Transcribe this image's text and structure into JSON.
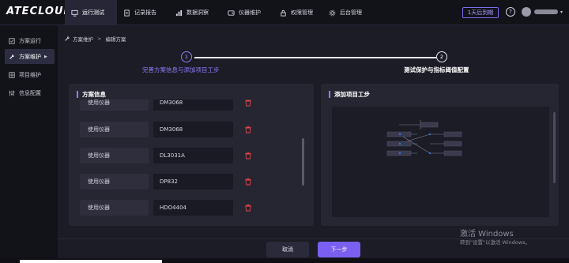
{
  "app": {
    "logo": "ATECLOUD"
  },
  "nav": [
    {
      "label": "运行测试",
      "icon": "monitor-icon",
      "active": true
    },
    {
      "label": "记录报告",
      "icon": "report-icon",
      "active": false
    },
    {
      "label": "数据洞察",
      "icon": "chart-icon",
      "active": false
    },
    {
      "label": "仪器维护",
      "icon": "instrument-icon",
      "active": false
    },
    {
      "label": "权限管理",
      "icon": "lock-icon",
      "active": false
    },
    {
      "label": "后台管理",
      "icon": "settings-icon",
      "active": false
    }
  ],
  "header": {
    "trial_label": "1天后到期",
    "help_label": "?"
  },
  "sidebar": [
    {
      "label": "方案运行",
      "icon": "play-icon",
      "active": false
    },
    {
      "label": "方案维护",
      "icon": "wrench-icon",
      "active": true,
      "caret": "▶"
    },
    {
      "label": "项目维护",
      "icon": "grid-icon",
      "active": false
    },
    {
      "label": "信息配置",
      "icon": "sliders-icon",
      "active": false
    }
  ],
  "breadcrumb": {
    "root": "方案维护",
    "separator": ">",
    "current": "编辑方案"
  },
  "steps": [
    {
      "number": "1",
      "label": "完善方案信息与添加项目工步",
      "active": true
    },
    {
      "number": "2",
      "label": "测试保护与指标阈值配置",
      "active": false
    }
  ],
  "left_panel": {
    "title": "方案信息",
    "rows": [
      {
        "label": "使用仪器",
        "value": "DM3068"
      },
      {
        "label": "使用仪器",
        "value": "DM3068"
      },
      {
        "label": "使用仪器",
        "value": "DL3031A"
      },
      {
        "label": "使用仪器",
        "value": "DP832"
      },
      {
        "label": "使用仪器",
        "value": "HDO4404"
      }
    ]
  },
  "right_panel": {
    "title": "添加项目工步"
  },
  "footer": {
    "cancel_label": "取消",
    "next_label": "下一步"
  },
  "watermark": {
    "line1": "激活 Windows",
    "line2": "转到\"设置\"以激活 Windows。"
  },
  "colors": {
    "accent": "#8f7df7",
    "button": "#7b5ff0",
    "delete": "#e2434b"
  }
}
